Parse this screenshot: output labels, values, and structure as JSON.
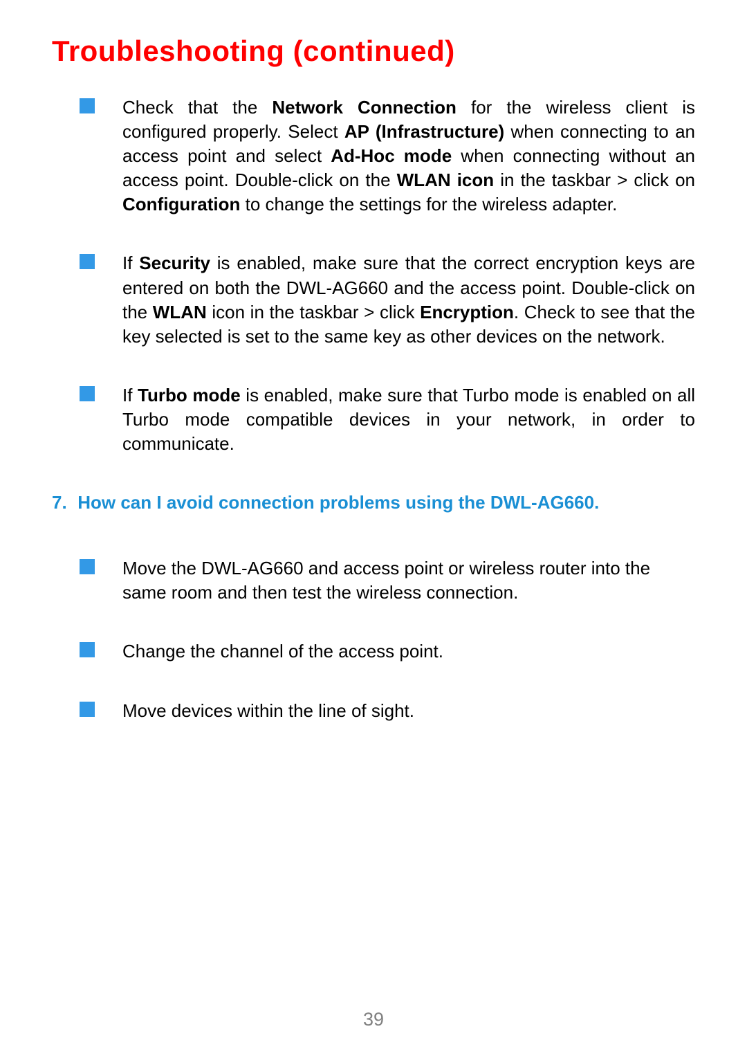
{
  "title": "Troubleshooting (continued)",
  "items_a": [
    {
      "pre1": "Check that the ",
      "b1": "Network Connection",
      "mid1": " for the wireless client is configured properly. Select ",
      "b2": "AP (Infrastructure)",
      "mid2": " when connecting to an access point and select ",
      "b3": "Ad-Hoc mode",
      "mid3": " when connecting without an access point. Double-click on the ",
      "b4": "WLAN icon",
      "mid4": " in the taskbar > click on ",
      "b5": "Configuration",
      "post": " to change the settings for the wireless adapter."
    },
    {
      "pre1": "If ",
      "b1": "Security",
      "mid1": " is enabled, make sure that the correct encryption keys are entered on both the DWL-AG660 and the access point. Double-click on the ",
      "b2": "WLAN",
      "mid2": " icon in the taskbar > click ",
      "b3": "Encryption",
      "post": ". Check to see that the key selected is set to the same key as other devices on the network."
    },
    {
      "pre1": "If ",
      "b1": "Turbo mode",
      "post": " is enabled, make sure that Turbo mode is enabled on all Turbo mode compatible devices in your network, in order to communicate."
    }
  ],
  "question": {
    "number": "7.",
    "text": "How can I avoid connection problems using the DWL-AG660."
  },
  "items_b": [
    "Move the DWL-AG660 and access point or wireless router into the same room and then test the wireless connection.",
    "Change the channel of the access point.",
    "Move devices within the line of sight."
  ],
  "page_number": "39"
}
